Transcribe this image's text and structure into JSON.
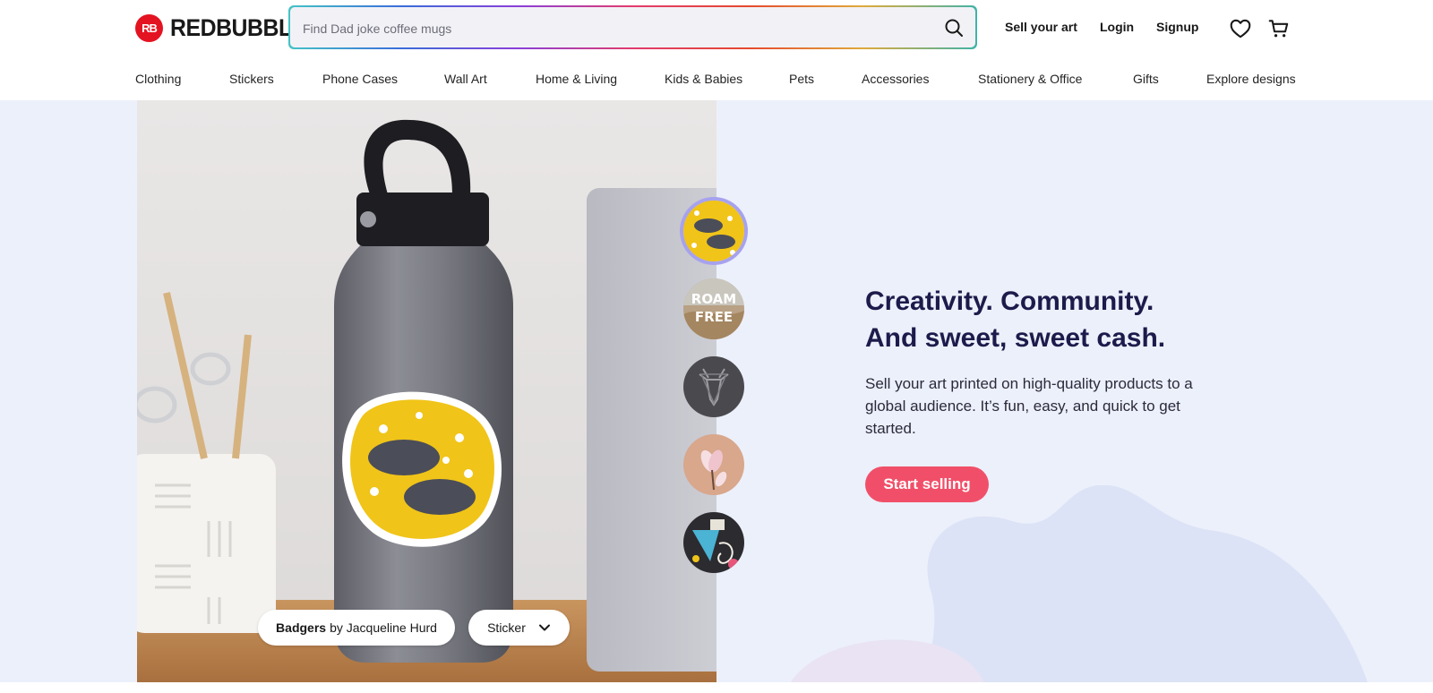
{
  "brand": {
    "logo_mark": "RB",
    "name": "REDBUBBLE",
    "color": "#e41321"
  },
  "search": {
    "placeholder": "Find Dad joke coffee mugs",
    "icon": "search-icon"
  },
  "header_links": {
    "sell": "Sell your art",
    "login": "Login",
    "signup": "Signup"
  },
  "header_icons": [
    "heart-icon",
    "cart-icon"
  ],
  "nav": {
    "items": [
      "Clothing",
      "Stickers",
      "Phone Cases",
      "Wall Art",
      "Home & Living",
      "Kids & Babies",
      "Pets",
      "Accessories",
      "Stationery & Office",
      "Gifts",
      "Explore designs"
    ]
  },
  "hero": {
    "headline_line1": "Creativity. Community.",
    "headline_line2": "And sweet, sweet cash.",
    "subtext": "Sell your art printed on high-quality products to a global audience. It’s fun, easy, and quick to get started.",
    "cta": "Start selling",
    "credit_title": "Badgers",
    "credit_by": "by Jacqueline Hurd",
    "product": "Sticker",
    "thumbnails": [
      {
        "name": "badgers-sticker",
        "active": true
      },
      {
        "name": "roam-free-sticker",
        "active": false,
        "text": "ROAM FREE"
      },
      {
        "name": "deer-sticker",
        "active": false
      },
      {
        "name": "magnolia-sticker",
        "active": false
      },
      {
        "name": "collage-sticker",
        "active": false
      }
    ]
  },
  "colors": {
    "accent": "#f14f69",
    "headline": "#1c1b4b",
    "hero_bg": "#ecf0fb",
    "active_ring": "#a7a2ee"
  }
}
